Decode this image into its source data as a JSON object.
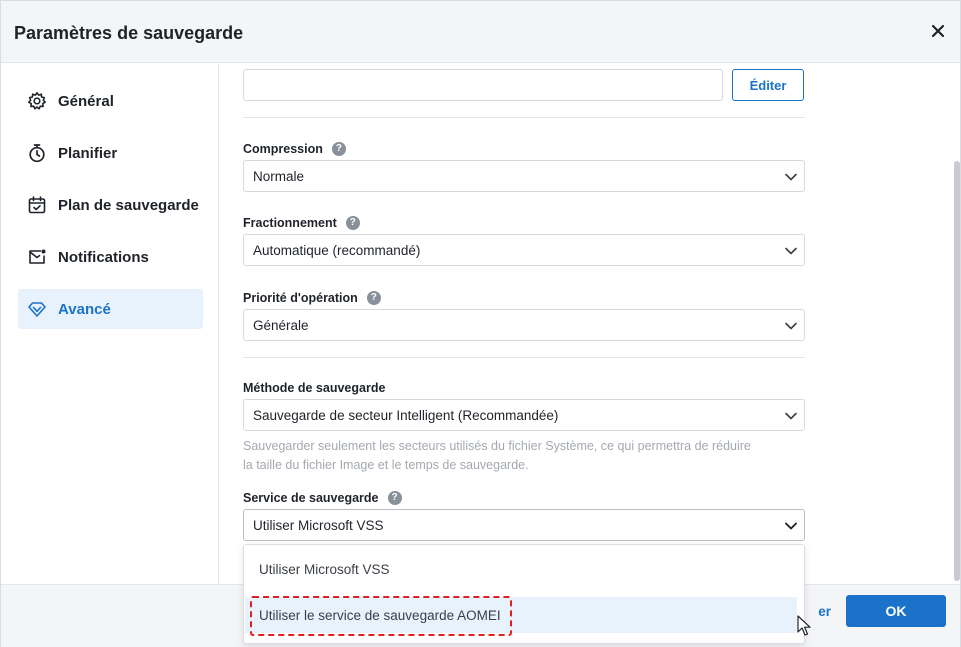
{
  "window": {
    "title": "Paramètres de sauvegarde"
  },
  "sidebar": {
    "items": [
      {
        "label": "Général",
        "icon": "gear-icon",
        "active": false
      },
      {
        "label": "Planifier",
        "icon": "stopwatch-icon",
        "active": false
      },
      {
        "label": "Plan de sauvegarde",
        "icon": "calendar-check-icon",
        "active": false
      },
      {
        "label": "Notifications",
        "icon": "mail-icon",
        "active": false
      },
      {
        "label": "Avancé",
        "icon": "diamond-icon",
        "active": true
      }
    ]
  },
  "content": {
    "comment_field": {
      "value": "",
      "edit_label": "Éditer"
    },
    "compression": {
      "label": "Compression",
      "value": "Normale"
    },
    "splitting": {
      "label": "Fractionnement",
      "value": "Automatique (recommandé)"
    },
    "priority": {
      "label": "Priorité d'opération",
      "value": "Générale"
    },
    "backup_method": {
      "label": "Méthode de sauvegarde",
      "value": "Sauvegarde de secteur Intelligent (Recommandée)",
      "description_line1": "Sauvegarder seulement les secteurs utilisés du fichier Système, ce qui permettra de réduire",
      "description_line2": "la taille du fichier Image et le temps de sauvegarde."
    },
    "backup_service": {
      "label": "Service de sauvegarde",
      "value": "Utiliser Microsoft VSS",
      "options": [
        "Utiliser Microsoft VSS",
        "Utiliser le service de sauvegarde AOMEI"
      ]
    }
  },
  "footer": {
    "cancel_label_visible": "er",
    "ok_label": "OK"
  },
  "colors": {
    "accent": "#1a73c9",
    "highlight": "#e0201f",
    "active_bg": "#e8f2fc"
  }
}
